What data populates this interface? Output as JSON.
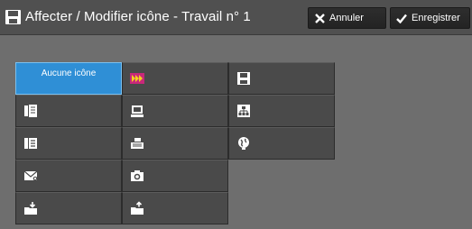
{
  "header": {
    "title": "Affecter / Modifier icône - Travail n° 1",
    "cancel_label": "Annuler",
    "save_label": "Enregistrer"
  },
  "icons": {
    "selected_label": "Aucune icône",
    "items": [
      "no-icon",
      "arrows-forward-icon",
      "floppy-disk-icon",
      "document-stack-icon",
      "monitor-icon",
      "network-hierarchy-icon",
      "fax-icon",
      "printer-icon",
      "globe-icon",
      "email-icon",
      "camera-icon",
      "folder-in-icon",
      "folder-out-icon"
    ]
  },
  "colors": {
    "accent": "#2f8fd6",
    "arrow_icon_magenta": "#c8287a",
    "arrow_icon_yellow": "#f2d21e"
  }
}
